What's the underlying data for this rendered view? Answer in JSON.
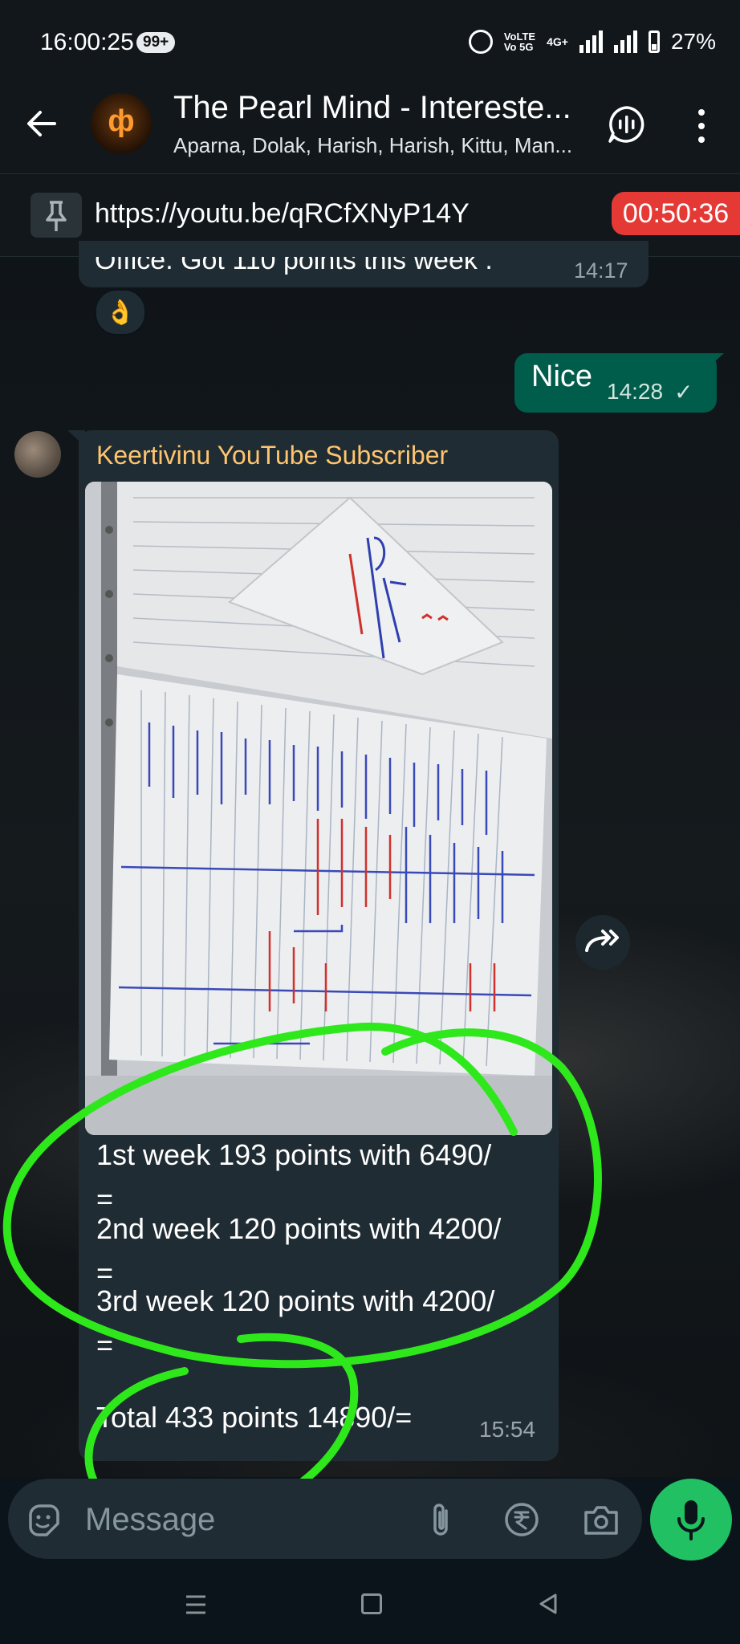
{
  "status_bar": {
    "time": "16:00:25",
    "notification_badge": "99+",
    "volte_top": "VoLTE",
    "volte_bottom": "Vo 5G",
    "network": "4G+",
    "battery": "27%"
  },
  "header": {
    "title": "The Pearl Mind - Intereste...",
    "subtitle": "Aparna, Dolak, Harish, Harish, Kittu, Man...",
    "avatar_glyph": "ф"
  },
  "pinned": {
    "link": "https://youtu.be/qRCfXNyP14Y",
    "call_timer": "00:50:36"
  },
  "messages": {
    "partial": {
      "text": "Office. Got 110 points this week .",
      "time": "14:17",
      "reaction": "👌"
    },
    "outgoing": {
      "text": "Nice",
      "time": "14:28",
      "status": "✓"
    },
    "incoming_image": {
      "sender": "Keertivinu YouTube Subscriber",
      "lines": [
        "1st week 193 points with 6490/",
        "=",
        "2nd week 120 points with 4200/",
        "=",
        "3rd week 120 points with 4200/",
        "=",
        "Total 433 points 14890/="
      ],
      "time": "15:54"
    }
  },
  "input": {
    "placeholder": "Message"
  },
  "colors": {
    "outgoing_bubble": "#005c4b",
    "incoming_bubble": "#202c33",
    "sender_name": "#fec56e",
    "call_timer": "#e53935",
    "mic_button": "#21c063",
    "annotation": "#2ee81c"
  },
  "icons": [
    "back-arrow-icon",
    "voice-chat-icon",
    "more-options-icon",
    "pin-icon",
    "forward-icon",
    "sticker-icon",
    "attach-icon",
    "rupee-icon",
    "camera-icon",
    "mic-icon"
  ]
}
